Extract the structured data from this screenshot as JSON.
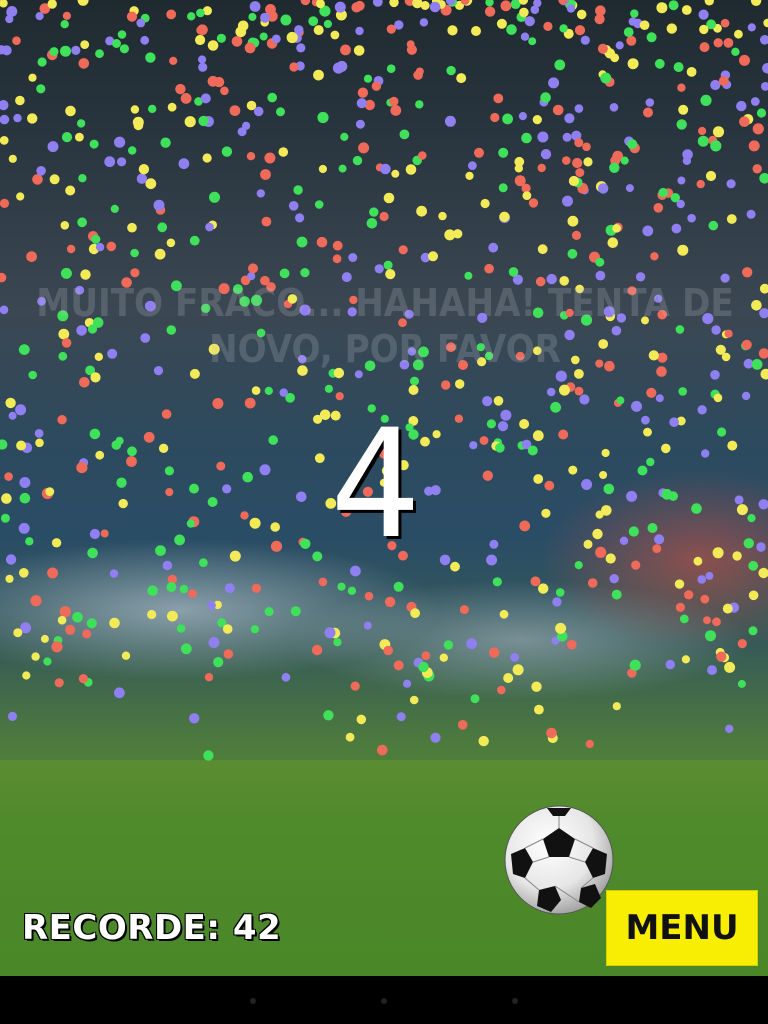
{
  "game": {
    "message": "MUITO FRACO... HAHAHA! TENTA DE NOVO, POR FAVOR",
    "score": "4",
    "record_label": "RECORDE: 42",
    "menu_label": "MENU"
  },
  "colors": {
    "confetti": [
      "#f06a5a",
      "#f3ea58",
      "#8f7ff0",
      "#3fe05a"
    ],
    "menu_button": "#f7ee04",
    "pitch": "#4f8a2b"
  },
  "icons": {
    "ball": "soccer-ball-icon",
    "nav": [
      "back-icon",
      "home-icon",
      "recent-apps-icon"
    ]
  }
}
